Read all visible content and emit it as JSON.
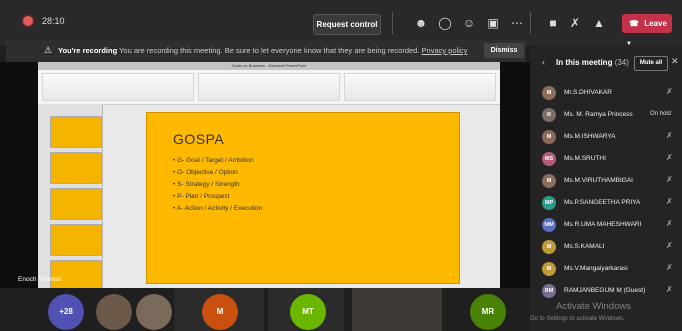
{
  "topbar": {
    "timer": "28:10",
    "request_control": "Request control",
    "leave": "Leave",
    "icons": [
      "people-icon",
      "chat-icon",
      "reactions-icon",
      "rooms-icon",
      "more-icon",
      "camera-off-icon",
      "mic-off-icon",
      "share-icon",
      "phone-icon"
    ]
  },
  "banner": {
    "strong": "You're recording",
    "text": "You are recording this meeting. Be sure to let everyone know that they are being recorded.",
    "link": "Privacy policy",
    "dismiss": "Dismiss"
  },
  "presentation": {
    "window_title": "Goals on Business - Microsoft PowerPoint",
    "slide_title": "GOSPA",
    "bullets": [
      "G- Goal / Target / Ambition",
      "O- Objective / Option",
      "S- Strategy / Strength",
      "P- Plan / Prospect",
      "A- Action / Activity / Execution"
    ],
    "presenter": "Enoch Thomas"
  },
  "bottom_tiles": [
    {
      "label": "+28",
      "color": "#4f52b2"
    },
    {
      "label": "M",
      "color": "#ca5010"
    },
    {
      "label": "MT",
      "color": "#6bb700"
    },
    {
      "label": "MR",
      "color": "#498205"
    }
  ],
  "panel": {
    "title": "In this meeting",
    "count": "(34)",
    "mute_all": "Mute all",
    "participants": [
      {
        "name": "Mr.S.DHIVAKAR",
        "initials": "M",
        "color": "#8b6d5a",
        "status": "mic"
      },
      {
        "name": "Ms. M. Ramya Princess",
        "initials": "R",
        "color": "#7a6e66",
        "status": "On hold"
      },
      {
        "name": "Ms.M.ISHWARYA",
        "initials": "M",
        "color": "#8a6a5a",
        "status": "mic"
      },
      {
        "name": "Ms.M.SRUTHI",
        "initials": "MS",
        "color": "#b55a7a",
        "status": "mic"
      },
      {
        "name": "Ms.M.VIRUTHAMBIGAI",
        "initials": "M",
        "color": "#8b6d5a",
        "status": "mic"
      },
      {
        "name": "Ms.P.SANGEETHA PRIYA",
        "initials": "MP",
        "color": "#2c9c8a",
        "status": "mic"
      },
      {
        "name": "Ms.R.UMA MAHESHWARI",
        "initials": "MM",
        "color": "#5a6fc4",
        "status": "mic"
      },
      {
        "name": "Ms.S.KAMALI",
        "initials": "M",
        "color": "#c09a3a",
        "status": "mic"
      },
      {
        "name": "Ms.V.Mangaiyarkarasi",
        "initials": "M",
        "color": "#c09a3a",
        "status": "mic"
      },
      {
        "name": "RAMJANBEGUM M (Guest)",
        "initials": "RM",
        "color": "#7a6e90",
        "status": "mic"
      }
    ]
  },
  "watermark": {
    "line1": "Activate Windows",
    "line2": "Go to Settings to activate Windows."
  }
}
